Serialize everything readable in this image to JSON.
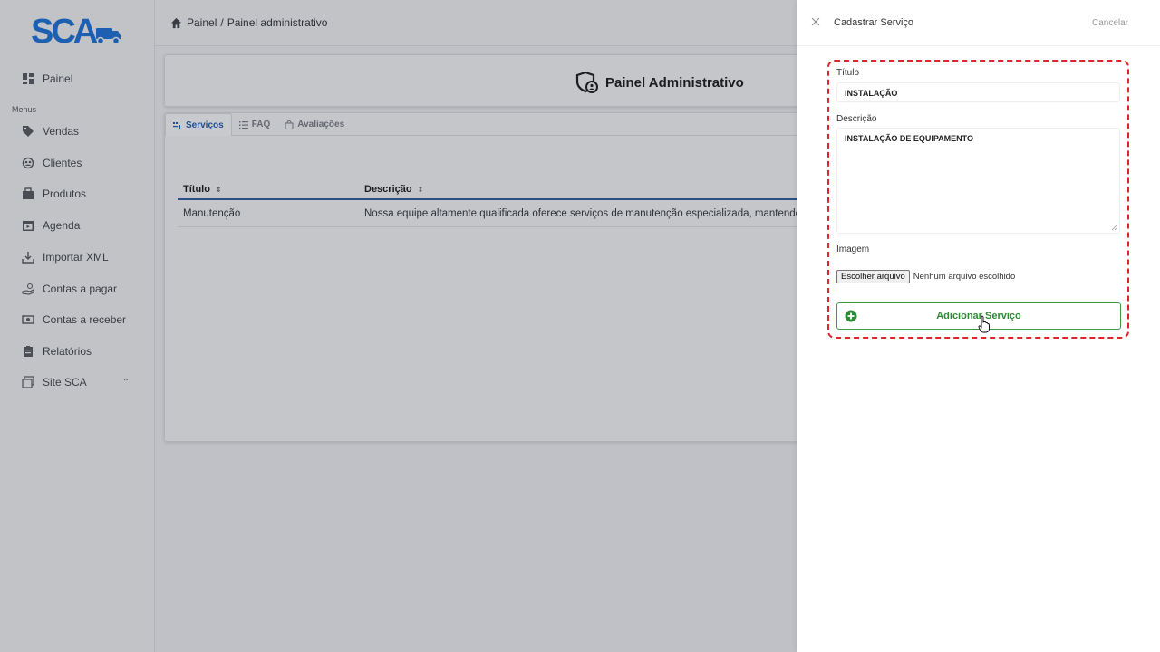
{
  "brand": {
    "logo_text": "SCA"
  },
  "sidebar": {
    "items_top": [
      {
        "label": "Painel",
        "icon": "dashboard-icon"
      }
    ],
    "menus_label": "Menus",
    "items": [
      {
        "label": "Vendas",
        "icon": "tag-icon"
      },
      {
        "label": "Clientes",
        "icon": "users-icon"
      },
      {
        "label": "Produtos",
        "icon": "box-icon"
      },
      {
        "label": "Agenda",
        "icon": "calendar-icon"
      },
      {
        "label": "Importar XML",
        "icon": "download-icon"
      },
      {
        "label": "Contas a pagar",
        "icon": "hand-money-icon"
      },
      {
        "label": "Contas a receber",
        "icon": "money-icon"
      },
      {
        "label": "Relatórios",
        "icon": "clipboard-icon"
      },
      {
        "label": "Site SCA",
        "icon": "window-icon"
      }
    ]
  },
  "breadcrumb": {
    "root": "Painel",
    "separator": "/",
    "current": "Painel administrativo"
  },
  "panel": {
    "title": "Painel Administrativo",
    "tabs": [
      {
        "label": "Serviços",
        "active": true
      },
      {
        "label": "FAQ",
        "active": false
      },
      {
        "label": "Avaliações",
        "active": false
      }
    ],
    "table": {
      "columns": [
        "Título",
        "Descrição"
      ],
      "rows": [
        {
          "titulo": "Manutenção",
          "descricao": "Nossa equipe altamente qualificada oferece serviços de manutenção especializada, mantendo"
        }
      ]
    }
  },
  "drawer": {
    "title": "Cadastrar Serviço",
    "cancel_label": "Cancelar",
    "fields": {
      "titulo_label": "Título",
      "titulo_value": "INSTALAÇÃO",
      "descricao_label": "Descrição",
      "descricao_value": "INSTALAÇÃO DE EQUIPAMENTO",
      "imagem_label": "Imagem",
      "file_button": "Escolher arquivo",
      "file_status": "Nenhum arquivo escolhido"
    },
    "submit_label": "Adicionar Serviço"
  },
  "colors": {
    "accent": "#1f4f8f",
    "success": "#2f8a38",
    "highlight": "#e0242b",
    "logo": "#1d5fb0"
  }
}
